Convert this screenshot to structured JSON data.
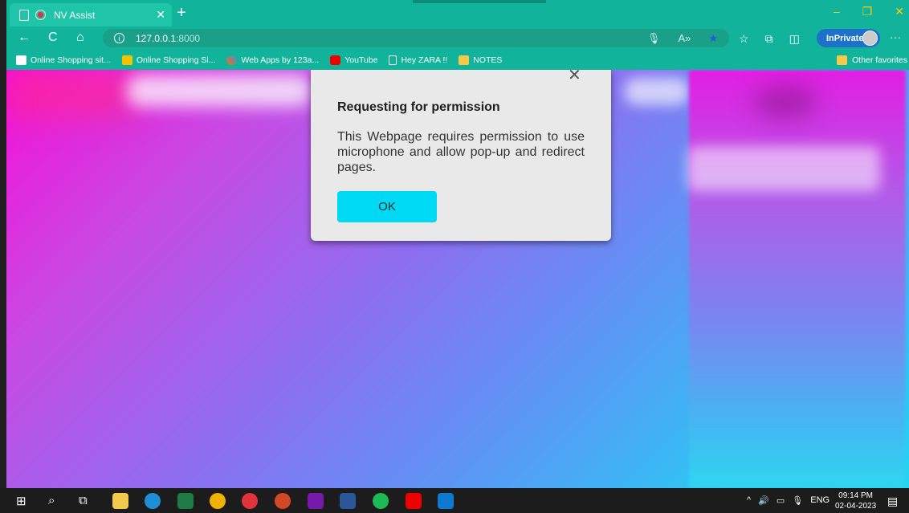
{
  "tab": {
    "title": "NV Assist",
    "close": "✕"
  },
  "newtab": "+",
  "window_controls": {
    "minimize": "–",
    "restore": "❐",
    "close": "✕"
  },
  "nav": {
    "back": "←",
    "refresh": "C",
    "home": "⌂"
  },
  "address": {
    "host": "127.0.0.1",
    "port": ":8000"
  },
  "inprivate": "InPrivate",
  "more": "···",
  "favorites": [
    {
      "label": "Online Shopping sit...",
      "icon": "amazon"
    },
    {
      "label": "Online Shopping Si...",
      "icon": "shop"
    },
    {
      "label": "Web Apps by 123a...",
      "icon": "web"
    },
    {
      "label": "YouTube",
      "icon": "yt"
    },
    {
      "label": "Hey ZARA !!",
      "icon": "doc"
    },
    {
      "label": "NOTES",
      "icon": "folder"
    }
  ],
  "favorites_other": "Other favorites",
  "dialog": {
    "close": "✕",
    "title": "Requesting for permission",
    "message": "This Webpage requires permission to use microphone and allow pop-up and redirect pages.",
    "ok": "OK"
  },
  "tray": {
    "up": "^",
    "volume": "🔊",
    "lang": "ENG"
  },
  "clock": {
    "time": "09:14 PM",
    "date": "02-04-2023"
  },
  "colors": {
    "chrome": "#12b39b",
    "dialog_button": "#00d9f4",
    "inprivate": "#1e71c8"
  }
}
